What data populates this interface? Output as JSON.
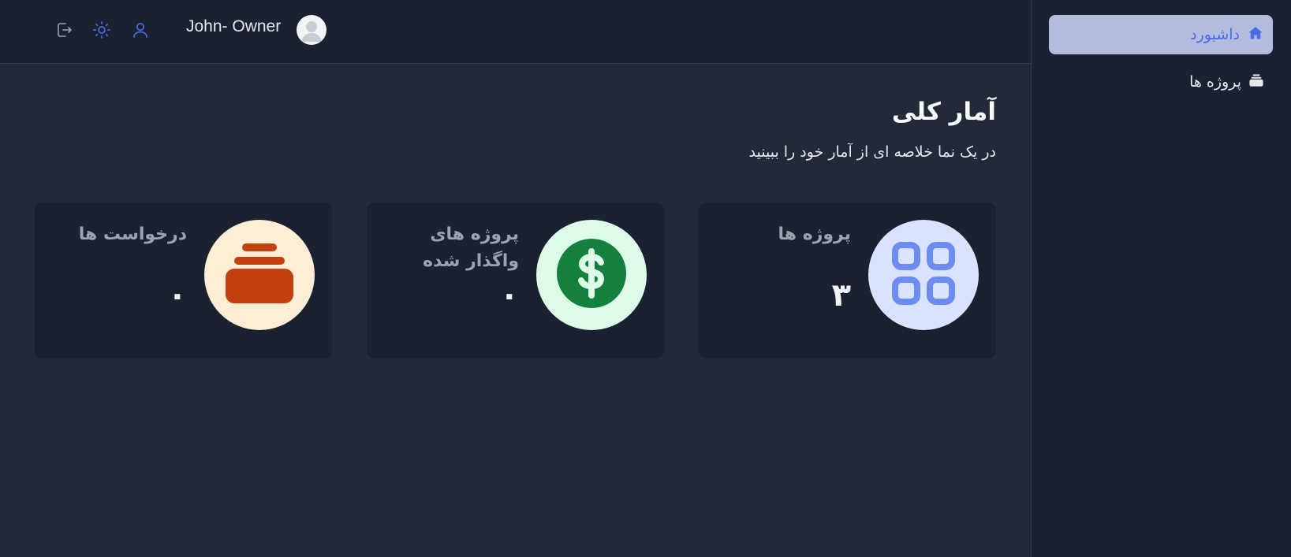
{
  "user": {
    "name": "John- Owner"
  },
  "sidebar": {
    "items": [
      {
        "label": "داشبورد",
        "icon": "home-icon",
        "active": true
      },
      {
        "label": "پروژه ها",
        "icon": "stack-icon",
        "active": false
      }
    ]
  },
  "header": {
    "icons": [
      "logout-icon",
      "sun-icon",
      "user-icon"
    ]
  },
  "main": {
    "title": "آمار کلی",
    "subtitle": "در یک نما خلاصه ای از آمار خود را ببینید",
    "stats": [
      {
        "label": "پروژه ها",
        "value": "۳",
        "icon": "grid-icon",
        "circle_color": "#dbe2ff",
        "icon_color": "#6b8cf0"
      },
      {
        "label": "پروژه های واگذار شده",
        "value": "۰",
        "icon": "dollar-icon",
        "circle_color": "#dcfce7",
        "icon_color": "#15803d"
      },
      {
        "label": "درخواست ها",
        "value": "۰",
        "icon": "stack-icon",
        "circle_color": "#ffedd5",
        "icon_color": "#c2410c"
      }
    ]
  },
  "colors": {
    "accent": "#4b6ae8",
    "active_bg": "#b4bcdc",
    "panel": "#1a2130",
    "page_bg": "#222a3a"
  }
}
